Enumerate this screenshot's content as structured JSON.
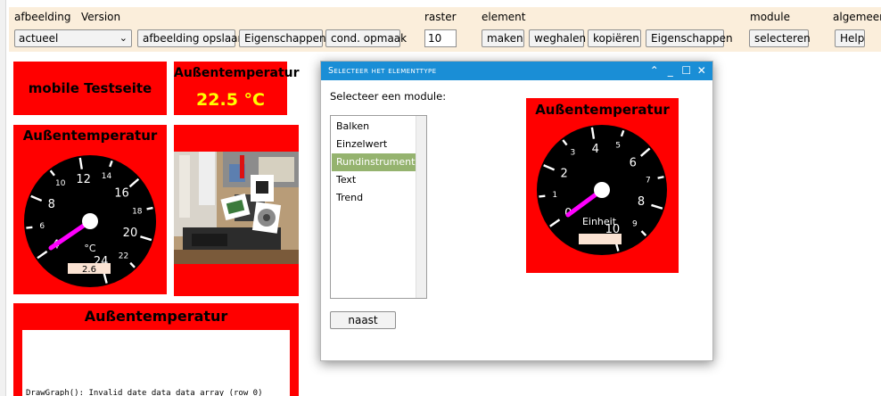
{
  "toolbar": {
    "afbeelding_label": "afbeelding",
    "version_label": "Version",
    "version_value": "actueel",
    "save_image": "afbeelding opslaan",
    "properties": "Eigenschappen",
    "cond_format": "cond. opmaak",
    "raster_label": "raster",
    "raster_value": "10",
    "element_label": "element",
    "make": "maken",
    "remove": "weghalen",
    "copy": "kopiëren",
    "element_properties": "Eigenschappen",
    "module_label": "module",
    "select": "selecteren",
    "general_label": "algemeen",
    "help": "Help"
  },
  "canvas": {
    "mobile_title": "mobile Testseite",
    "temp_title": "Außentemperatur",
    "temp_value": "22.5 °C",
    "gauge_title": "Außentemperatur",
    "gauge_unit": "°C",
    "gauge_value": "2.6",
    "gauge_ticks": [
      "4",
      "6",
      "8",
      "10",
      "12",
      "14",
      "16",
      "18",
      "20",
      "22",
      "24"
    ],
    "trend_title": "Außentemperatur",
    "trend_error": "DrawGraph(): Invalid date data data array (row 0)"
  },
  "modal": {
    "title": "Selecteer het elementtype",
    "prompt": "Selecteer een module:",
    "items": [
      "Balken",
      "Einzelwert",
      "Rundinstrument",
      "Text",
      "Trend"
    ],
    "selected_index": 2,
    "next": "naast",
    "preview": {
      "title": "Außentemperatur",
      "unit": "Einheit",
      "ticks": [
        "0",
        "1",
        "2",
        "3",
        "4",
        "5",
        "6",
        "7",
        "8",
        "9",
        "10"
      ]
    }
  },
  "colors": {
    "widget_bg": "#ff0000",
    "toolbar_bg": "#fbeedb",
    "header_bg": "#1a8ed6",
    "selected_item": "#95b36f",
    "temp_value": "#ffff00",
    "needle": "#ff00ff"
  }
}
